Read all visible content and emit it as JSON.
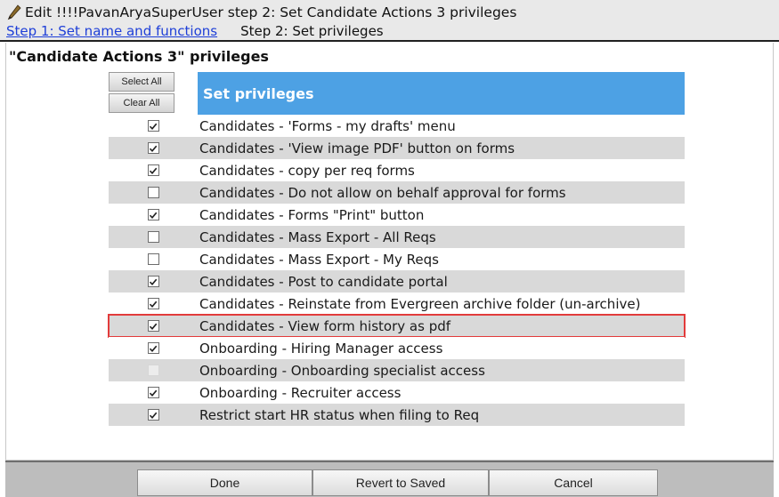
{
  "window": {
    "title": "Edit !!!!PavanAryaSuperUser step 2: Set Candidate Actions 3 privileges",
    "step1_link": "Step 1: Set name and functions",
    "step2_label": "Step 2: Set privileges"
  },
  "section": {
    "title": "\"Candidate Actions 3\" privileges"
  },
  "table": {
    "select_all_label": "Select All",
    "clear_all_label": "Clear All",
    "header_label": "Set privileges",
    "highlight_color": "#e23b3b",
    "header_color": "#4da1e4",
    "rows": [
      {
        "label": "Candidates - 'Forms - my drafts' menu",
        "checked": true,
        "disabled": false
      },
      {
        "label": "Candidates - 'View image PDF' button on forms",
        "checked": true,
        "disabled": false
      },
      {
        "label": "Candidates - copy per req forms",
        "checked": true,
        "disabled": false
      },
      {
        "label": "Candidates - Do not allow on behalf approval for forms",
        "checked": false,
        "disabled": false
      },
      {
        "label": "Candidates - Forms \"Print\" button",
        "checked": true,
        "disabled": false
      },
      {
        "label": "Candidates - Mass Export - All Reqs",
        "checked": false,
        "disabled": false
      },
      {
        "label": "Candidates - Mass Export - My Reqs",
        "checked": false,
        "disabled": false
      },
      {
        "label": "Candidates - Post to candidate portal",
        "checked": true,
        "disabled": false
      },
      {
        "label": "Candidates - Reinstate from Evergreen archive folder (un-archive)",
        "checked": true,
        "disabled": false
      },
      {
        "label": "Candidates - View form history as pdf",
        "checked": true,
        "disabled": false,
        "highlighted": true
      },
      {
        "label": "Onboarding - Hiring Manager access",
        "checked": true,
        "disabled": false
      },
      {
        "label": "Onboarding - Onboarding specialist access",
        "checked": false,
        "disabled": true
      },
      {
        "label": "Onboarding - Recruiter access",
        "checked": true,
        "disabled": false
      },
      {
        "label": "Restrict start HR status when filing to Req",
        "checked": true,
        "disabled": false
      }
    ]
  },
  "footer": {
    "done_label": "Done",
    "revert_label": "Revert to Saved",
    "cancel_label": "Cancel"
  }
}
